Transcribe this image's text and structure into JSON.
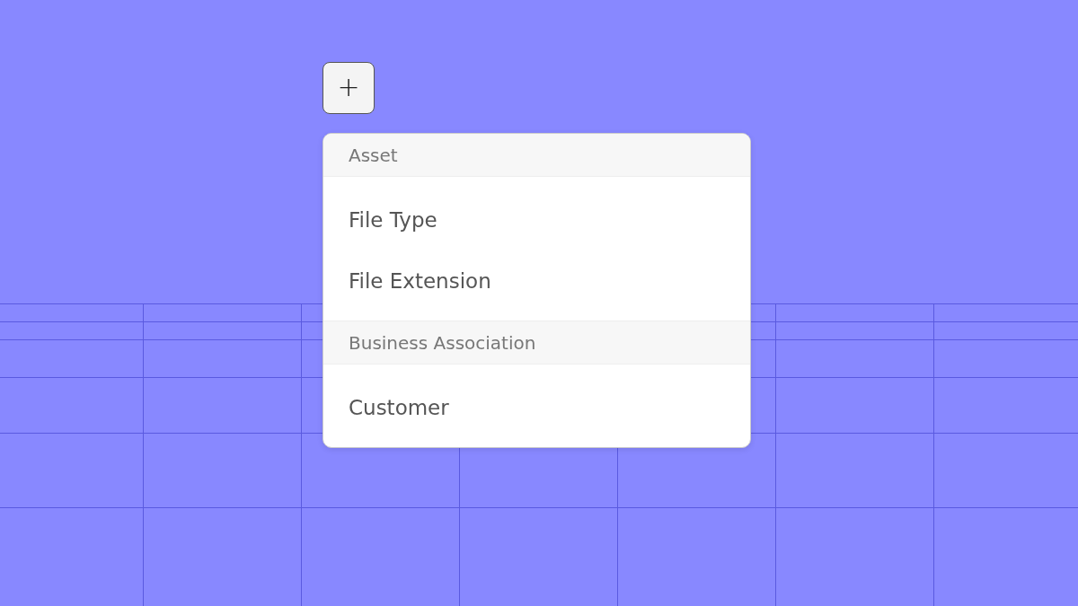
{
  "add_button": {
    "label": "+"
  },
  "menu": {
    "sections": [
      {
        "header": "Asset",
        "items": [
          {
            "label": "File Type"
          },
          {
            "label": "File Extension"
          }
        ]
      },
      {
        "header": "Business Association",
        "items": [
          {
            "label": "Customer"
          }
        ]
      }
    ]
  }
}
